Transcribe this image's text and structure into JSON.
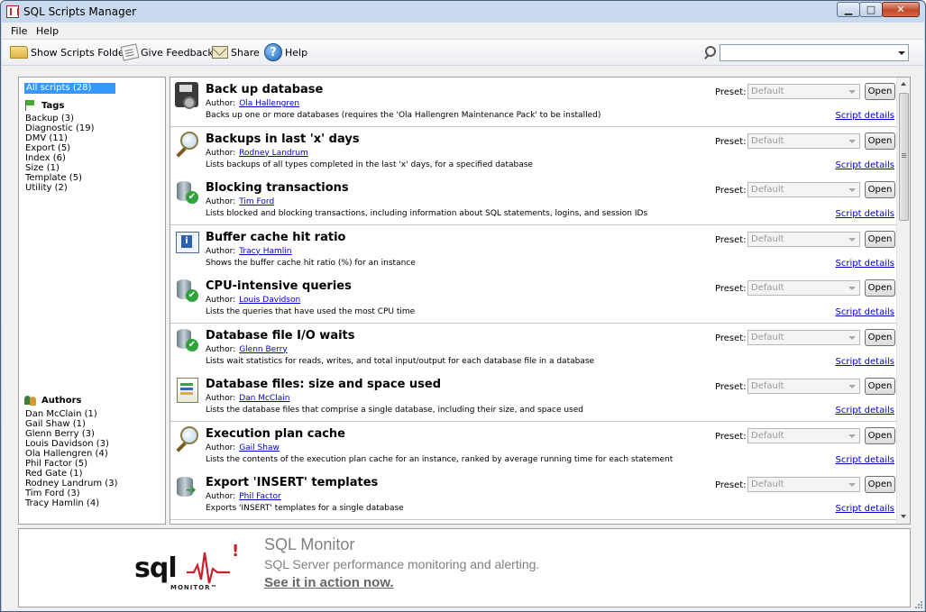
{
  "window": {
    "title": "SQL Scripts Manager"
  },
  "menu": [
    "File",
    "Help"
  ],
  "toolbar": {
    "show_folder": "Show Scripts Folder",
    "give_feedback": "Give Feedback",
    "share": "Share",
    "help": "Help",
    "search_value": ""
  },
  "sidebar": {
    "all_scripts": "All scripts (28)",
    "tags_heading": "Tags",
    "tags": [
      "Backup (3)",
      "Diagnostic (19)",
      "DMV (11)",
      "Export (5)",
      "Index (6)",
      "Size (1)",
      "Template (5)",
      "Utility (2)"
    ],
    "authors_heading": "Authors",
    "authors": [
      "Dan McClain (1)",
      "Gail Shaw (1)",
      "Glenn Berry (3)",
      "Louis Davidson (3)",
      "Ola Hallengren (4)",
      "Phil Factor (5)",
      "Red Gate (1)",
      "Rodney Landrum (3)",
      "Tim Ford (3)",
      "Tracy Hamlin (4)"
    ]
  },
  "labels": {
    "author": "Author:",
    "preset": "Preset:",
    "open": "Open",
    "details": "Script details"
  },
  "scripts": [
    {
      "name": "Back up database",
      "author": "Ola Hallengren",
      "desc": "Backs up one or more databases (requires the 'Ola Hallengren Maintenance Pack' to be installed)",
      "preset": "Default",
      "icon": "database-backup-icon"
    },
    {
      "name": "Backups in last 'x' days",
      "author": "Rodney Landrum",
      "desc": "Lists backups of all types completed in the last 'x' days, for a specified database",
      "preset": "Default",
      "icon": "magnifier-icon"
    },
    {
      "name": "Blocking transactions",
      "author": "Tim Ford",
      "desc": "Lists blocked and blocking transactions, including information about SQL statements, logins, and session IDs",
      "preset": "Default",
      "icon": "database-check-icon"
    },
    {
      "name": "Buffer cache hit ratio",
      "author": "Tracy Hamlin",
      "desc": "Shows the buffer cache hit ratio (%) for an instance",
      "preset": "Default",
      "icon": "info-panel-icon"
    },
    {
      "name": "CPU-intensive queries",
      "author": "Louis Davidson",
      "desc": "Lists the queries that have used the most CPU time",
      "preset": "Default",
      "icon": "database-check-icon"
    },
    {
      "name": "Database file I/O waits",
      "author": "Glenn Berry",
      "desc": "Lists wait statistics for reads, writes, and total input/output for each database file in a database",
      "preset": "Default",
      "icon": "database-check-icon"
    },
    {
      "name": "Database files: size and space used",
      "author": "Dan McClain",
      "desc": "Lists the database files that comprise a single database, including their size, and space used",
      "preset": "Default",
      "icon": "report-book-icon"
    },
    {
      "name": "Execution plan cache",
      "author": "Gail Shaw",
      "desc": "Lists the contents of the execution plan cache for an instance, ranked by average running time for each statement",
      "preset": "Default",
      "icon": "magnifier-icon"
    },
    {
      "name": "Export 'INSERT' templates",
      "author": "Phil Factor",
      "desc": "Exports 'INSERT' templates for a single database",
      "preset": "Default",
      "icon": "database-export-icon"
    }
  ],
  "ad": {
    "logo_sql": "sql",
    "logo_monitor": "MONITOR™",
    "logo_mark": "!",
    "title": "SQL Monitor",
    "subtitle": "SQL Server performance monitoring and alerting.",
    "cta": "See it in action now."
  }
}
